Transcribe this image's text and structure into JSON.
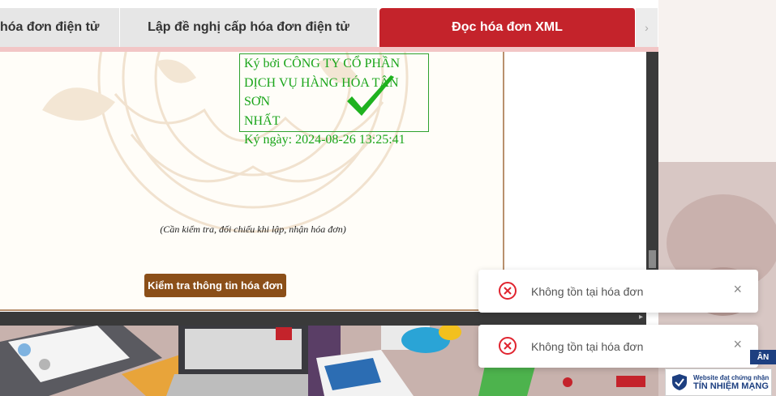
{
  "tabs": [
    {
      "label": "hóa đơn điện tử"
    },
    {
      "label": "Lập đề nghị cấp hóa đơn điện tử"
    },
    {
      "label": "Đọc hóa đơn XML"
    }
  ],
  "tab_scroll": "›",
  "signature": {
    "line1": "Ký bởi CÔNG TY CỔ PHẦN",
    "line2": "DỊCH VỤ HÀNG HÓA TÂN SƠN",
    "line3": "NHẤT",
    "line4": "Ký ngày: 2024-08-26 13:25:41"
  },
  "note": "(Cần kiểm tra, đối chiếu khi lập, nhận hóa đơn)",
  "check_button": "Kiểm tra thông tin hóa đơn",
  "toasts": [
    {
      "message": "Không tồn tại hóa đơn",
      "close": "×"
    },
    {
      "message": "Không tồn tại hóa đơn",
      "close": "×"
    }
  ],
  "badge": {
    "line1": "Website đạt chứng nhận",
    "line2": "TÍN NHIỆM MẠNG",
    "tag": "ÂN"
  },
  "colors": {
    "active_tab": "#c4232b",
    "button": "#8b4f19",
    "signature": "#1aa51a",
    "error": "#e0242f"
  }
}
